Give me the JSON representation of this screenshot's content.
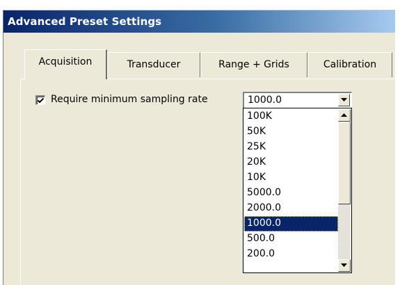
{
  "window": {
    "title": "Advanced Preset Settings"
  },
  "tabs": [
    {
      "label": "Acquisition",
      "active": true
    },
    {
      "label": "Transducer",
      "active": false
    },
    {
      "label": "Range + Grids",
      "active": false
    },
    {
      "label": "Calibration",
      "active": false
    }
  ],
  "acquisition": {
    "require_min_rate": {
      "label": "Require minimum sampling rate",
      "checked": true
    },
    "sampling_rate": {
      "value": "1000.0",
      "options": [
        "100K",
        "50K",
        "25K",
        "20K",
        "10K",
        "5000.0",
        "2000.0",
        "1000.0",
        "500.0",
        "200.0"
      ],
      "selected_index": 7
    }
  },
  "colors": {
    "titlebar_start": "#0a246a",
    "titlebar_end": "#a6caf0",
    "selection": "#0a246a",
    "dialog_bg": "#ece9d8"
  }
}
